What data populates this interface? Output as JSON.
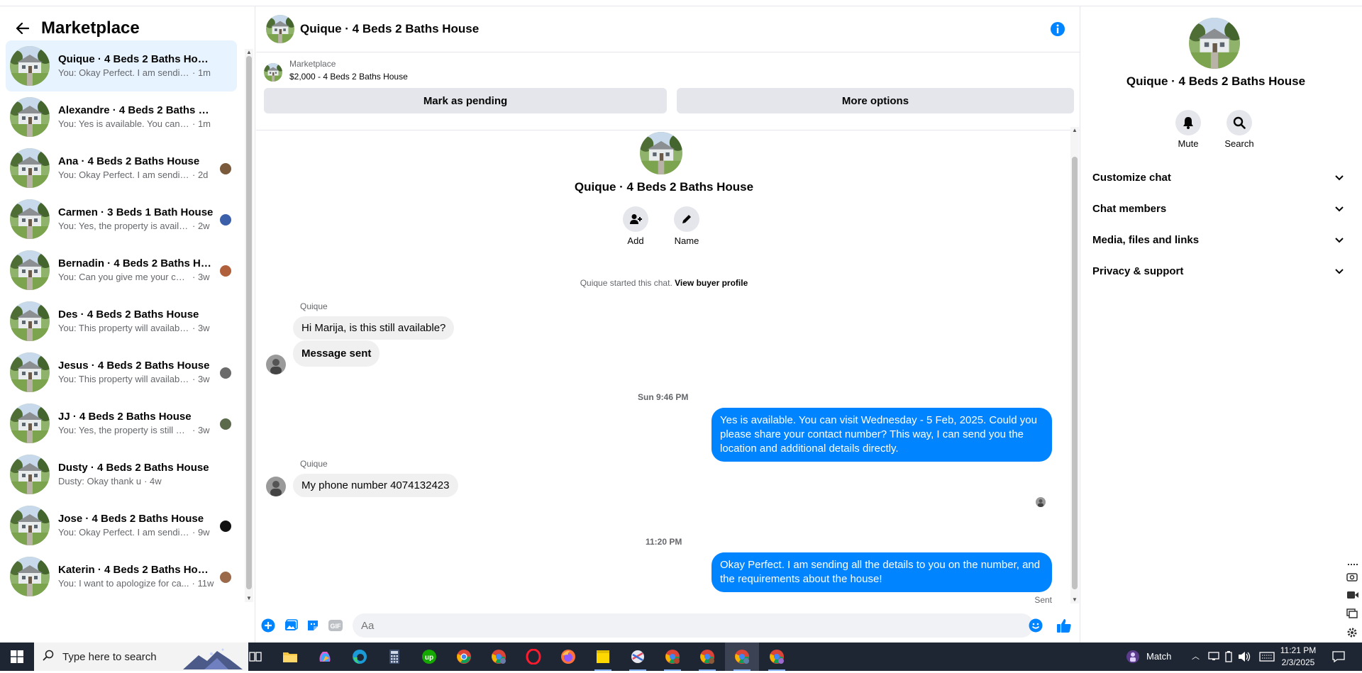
{
  "sidebar": {
    "title": "Marketplace",
    "conversations": [
      {
        "name": "Quique · 4 Beds 2 Baths House",
        "preview": "You: Okay Perfect. I am sending all...",
        "time": "· 1m",
        "read": ""
      },
      {
        "name": "Alexandre · 4 Beds 2 Baths House",
        "preview": "You: Yes is available. You can visit ...",
        "time": "· 1m",
        "read": ""
      },
      {
        "name": "Ana · 4 Beds 2 Baths House",
        "preview": "You: Okay Perfect. I am sending ...",
        "time": "· 2d",
        "read": "#7a5a3a"
      },
      {
        "name": "Carmen · 3 Beds 1 Bath House",
        "preview": "You: Yes, the property is availabl...",
        "time": "· 2w",
        "read": "#3b5fa8"
      },
      {
        "name": "Bernadin · 4 Beds 2 Baths Ho...",
        "preview": "You: Can you give me your cont...",
        "time": "· 3w",
        "read": "#b0603a"
      },
      {
        "name": "Des · 4 Beds 2 Baths House",
        "preview": "You: This property will available in, ...",
        "time": "· 3w",
        "read": ""
      },
      {
        "name": "Jesus · 4 Beds 2 Baths House",
        "preview": "You: This property will available ...",
        "time": "· 3w",
        "read": "#6b6b6b"
      },
      {
        "name": "JJ · 4 Beds 2 Baths House",
        "preview": "You: Yes, the property is still ava...",
        "time": "· 3w",
        "read": "#5a6a4a"
      },
      {
        "name": "Dusty · 4 Beds 2 Baths House",
        "preview": "Dusty: Okay thank u",
        "time": "· 4w",
        "read": ""
      },
      {
        "name": "Jose · 4 Beds 2 Baths House",
        "preview": "You: Okay Perfect. I am sending ...",
        "time": "· 9w",
        "read": "#111111"
      },
      {
        "name": "Katerin · 4 Beds 2 Baths House",
        "preview": "You: I want to apologize for ca...",
        "time": "· 11w",
        "read": "#9a6a4a"
      }
    ]
  },
  "chat": {
    "title": "Quique · 4 Beds 2 Baths House",
    "marketplace_label": "Marketplace",
    "listing": "$2,000 - 4 Beds 2 Baths House",
    "mark_pending": "Mark as pending",
    "more_options": "More options",
    "intro_title": "Quique · 4 Beds 2 Baths House",
    "add_label": "Add",
    "name_label": "Name",
    "started_text": "Quique started this chat.",
    "buyer_profile_link": "View buyer profile",
    "sender1": "Quique",
    "msg1": "Hi Marija, is this still available?",
    "msg2": "Message sent",
    "ts1": "Sun 9:46 PM",
    "msg3": "Yes is available. You can visit Wednesday - 5 Feb, 2025. Could you please share your contact number? This way, I can send you the location and additional details directly.",
    "sender2": "Quique",
    "msg4": "My phone number 4074132423",
    "ts2": "11:20 PM",
    "msg5": "Okay Perfect. I am sending all the details to you on the number, and the requirements about the house!",
    "sent_label": "Sent",
    "composer_placeholder": "Aa"
  },
  "details": {
    "title": "Quique · 4 Beds 2 Baths House",
    "mute_label": "Mute",
    "search_label": "Search",
    "rows": [
      "Customize chat",
      "Chat members",
      "Media, files and links",
      "Privacy & support"
    ]
  },
  "taskbar": {
    "search_placeholder": "Type here to search",
    "weather": "Match",
    "time": "11:21 PM",
    "date": "2/3/2025"
  },
  "colors": {
    "accent": "#0084ff",
    "selected_bg": "#e7f3ff",
    "taskbar": "#1f2633"
  }
}
